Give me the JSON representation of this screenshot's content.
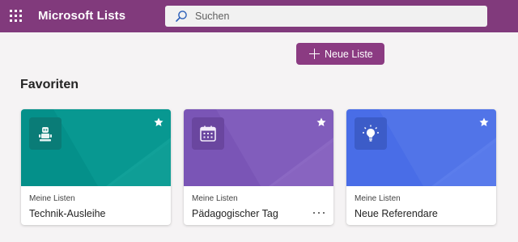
{
  "header": {
    "app_title": "Microsoft Lists",
    "search_placeholder": "Suchen",
    "icons": {
      "launcher": "waffle-icon",
      "search": "search-icon"
    },
    "color": "#813a7c"
  },
  "actions": {
    "new_list_label": "Neue Liste",
    "new_list_icon": "plus-icon",
    "color": "#8b3b82"
  },
  "favorites": {
    "title": "Favoriten",
    "cards": [
      {
        "subtitle": "Meine Listen",
        "name": "Technik-Ausleihe",
        "icon": "robot-icon",
        "color": "#05918a",
        "favorite": true
      },
      {
        "subtitle": "Meine Listen",
        "name": "Pädagogischer Tag",
        "icon": "calendar-icon",
        "color": "#7c56b8",
        "favorite": true,
        "more_icon": "more-options-icon"
      },
      {
        "subtitle": "Meine Listen",
        "name": "Neue Referendare",
        "icon": "lightbulb-icon",
        "color": "#4a6ee8",
        "favorite": true
      }
    ]
  }
}
